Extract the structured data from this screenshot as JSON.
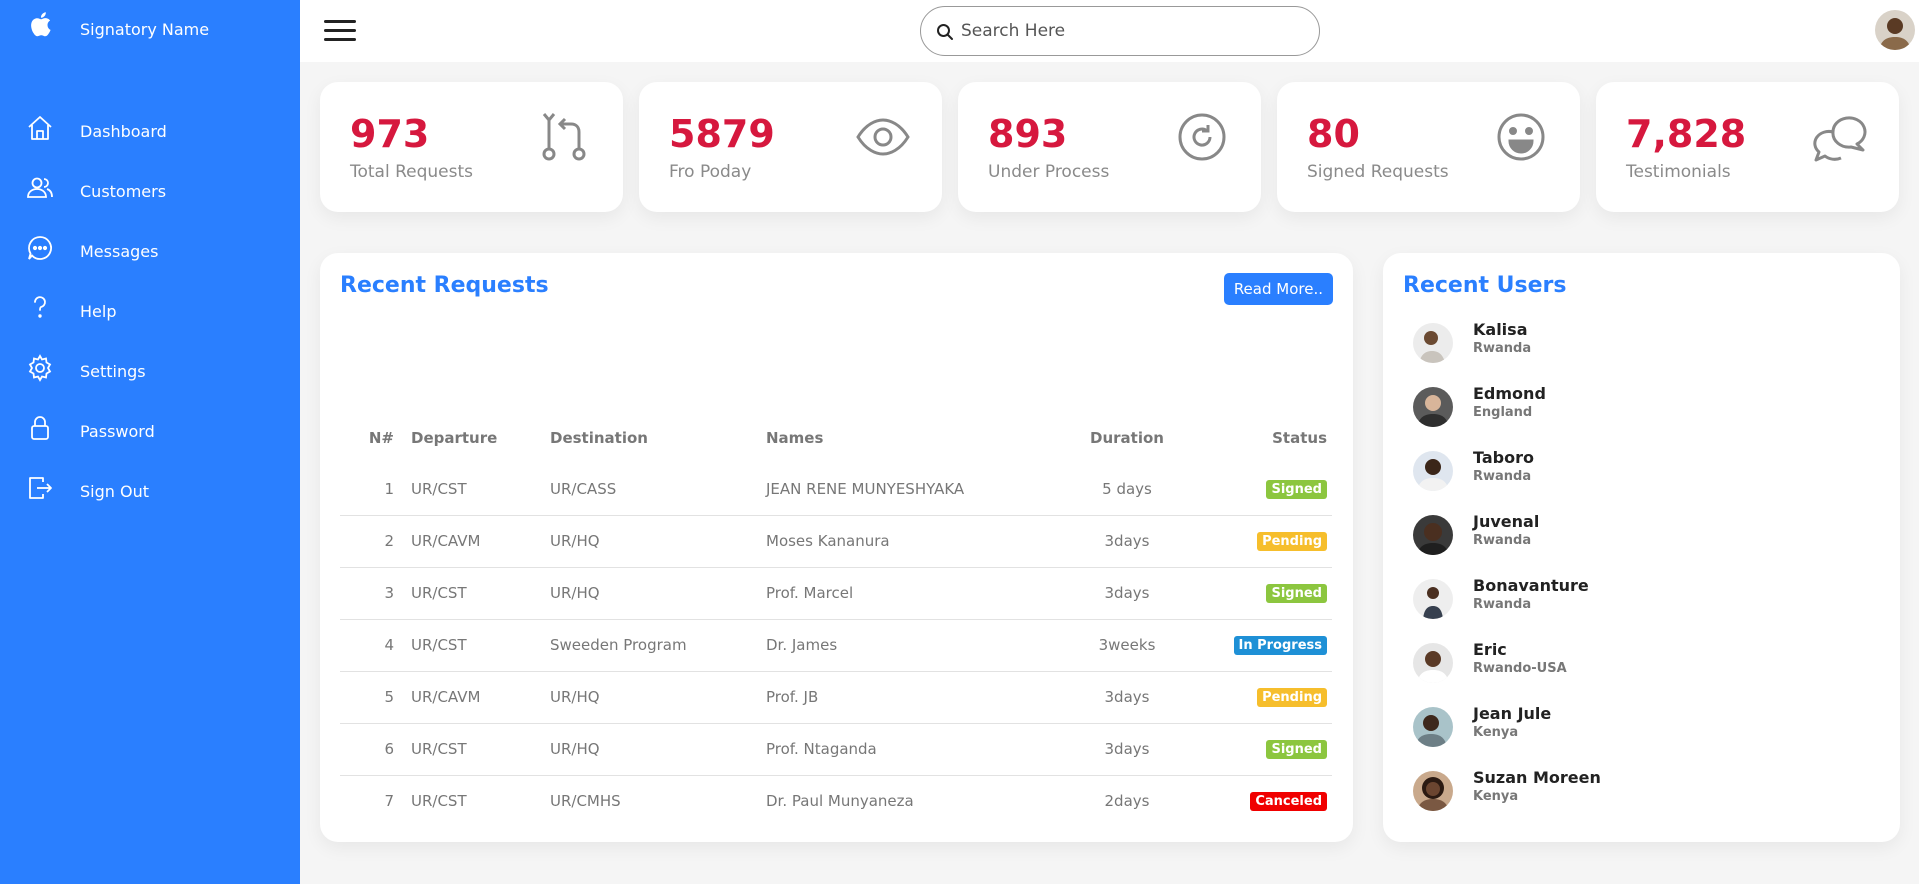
{
  "brand": {
    "name": "Signatory Name"
  },
  "sidebar": {
    "items": [
      {
        "label": "Dashboard",
        "icon": "home-icon"
      },
      {
        "label": "Customers",
        "icon": "users-icon"
      },
      {
        "label": "Messages",
        "icon": "chat-icon"
      },
      {
        "label": "Help",
        "icon": "help-icon"
      },
      {
        "label": "Settings",
        "icon": "gear-icon"
      },
      {
        "label": "Password",
        "icon": "lock-icon"
      },
      {
        "label": "Sign Out",
        "icon": "sign-out-icon"
      }
    ]
  },
  "search": {
    "placeholder": "Search Here"
  },
  "cards": [
    {
      "value": "973",
      "label": "Total Requests",
      "icon": "git-compare-icon"
    },
    {
      "value": "5879",
      "label": "Fro Poday",
      "icon": "eye-icon"
    },
    {
      "value": "893",
      "label": "Under Process",
      "icon": "refresh-icon"
    },
    {
      "value": "80",
      "label": "Signed Requests",
      "icon": "smile-icon"
    },
    {
      "value": "7,828",
      "label": "Testimonials",
      "icon": "chat-bubbles-icon"
    }
  ],
  "requests": {
    "title": "Recent Requests",
    "read_more": "Read More..",
    "headers": [
      "N#",
      "Departure",
      "Destination",
      "Names",
      "Duration",
      "Status"
    ],
    "rows": [
      {
        "n": "1",
        "departure": "UR/CST",
        "destination": "UR/CASS",
        "name": "JEAN RENE MUNYESHYAKA",
        "duration": "5 days",
        "status": "Signed"
      },
      {
        "n": "2",
        "departure": "UR/CAVM",
        "destination": "UR/HQ",
        "name": "Moses Kananura",
        "duration": "3days",
        "status": "Pending"
      },
      {
        "n": "3",
        "departure": "UR/CST",
        "destination": "UR/HQ",
        "name": "Prof. Marcel",
        "duration": "3days",
        "status": "Signed"
      },
      {
        "n": "4",
        "departure": "UR/CST",
        "destination": "Sweeden Program",
        "name": "Dr. James",
        "duration": "3weeks",
        "status": "In Progress"
      },
      {
        "n": "5",
        "departure": "UR/CAVM",
        "destination": "UR/HQ",
        "name": "Prof. JB",
        "duration": "3days",
        "status": "Pending"
      },
      {
        "n": "6",
        "departure": "UR/CST",
        "destination": "UR/HQ",
        "name": "Prof. Ntaganda",
        "duration": "3days",
        "status": "Signed"
      },
      {
        "n": "7",
        "departure": "UR/CST",
        "destination": "UR/CMHS",
        "name": "Dr. Paul Munyaneza",
        "duration": "2days",
        "status": "Canceled"
      }
    ]
  },
  "status_colors": {
    "Signed": "#8cc63f",
    "Pending": "#f6be2c",
    "In Progress": "#1e90d6",
    "Canceled": "#f00000"
  },
  "users": {
    "title": "Recent Users",
    "items": [
      {
        "name": "Kalisa",
        "country": "Rwanda"
      },
      {
        "name": "Edmond",
        "country": "England"
      },
      {
        "name": "Taboro",
        "country": "Rwanda"
      },
      {
        "name": "Juvenal",
        "country": "Rwanda"
      },
      {
        "name": "Bonavanture",
        "country": "Rwanda"
      },
      {
        "name": "Eric",
        "country": "Rwando-USA"
      },
      {
        "name": "Jean Jule",
        "country": "Kenya"
      },
      {
        "name": "Suzan Moreen",
        "country": "Kenya"
      }
    ]
  },
  "colors": {
    "accent": "#2a7fff",
    "card_number": "#d6183e"
  }
}
